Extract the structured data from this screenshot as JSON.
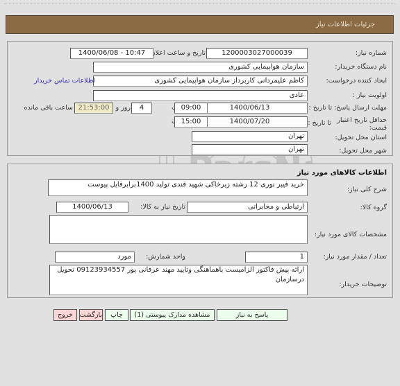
{
  "header": {
    "title": "جزئیات اطلاعات نیاز"
  },
  "details": {
    "need_number_label": "شماره نیاز:",
    "need_number": "1200003027000039",
    "announce_label": "تاریخ و ساعت اعلان عمومی:",
    "announce_value": "1400/06/08 - 10:47",
    "buyer_org_label": "نام دستگاه خریدار:",
    "buyer_org": "سازمان هواپیمایی کشوری",
    "creator_label": "ایجاد کننده درخواست:",
    "creator": "کاظم  علیمردانی کاربرداز سازمان هواپیمایی کشوری",
    "contact_link": "اطلاعات تماس خریدار",
    "priority_label": "اولویت نیاز :",
    "priority": "عادی",
    "deadline_label": "مهلت ارسال پاسخ: تا تاریخ :",
    "deadline_date": "1400/06/13",
    "time_label": "ساعت",
    "deadline_time": "09:00",
    "days_remaining": "4",
    "days_label": "روز و",
    "time_remaining": "21:53:00",
    "remaining_label": "ساعت باقی مانده",
    "validity_label": "حداقل تاریخ اعتبار قیمت:",
    "validity_to_label": "تا تاریخ :",
    "validity_date": "1400/07/20",
    "validity_time": "15:00",
    "province_label": "استان محل تحویل:",
    "province": "تهران",
    "city_label": "شهر محل تحویل:",
    "city": "تهران"
  },
  "goods": {
    "section_title": "اطلاعات کالاهای مورد نیاز",
    "description_label": "شرح کلی نیاز:",
    "description": "خرید فیبر نوری 12 رشته زیرخاکی شهید قندی تولید 1400برابرفایل پیوست",
    "group_label": "گروه کالا:",
    "group": "ارتباطی و مخابراتی",
    "need_date_label": "تاریخ نیاز به کالا:",
    "need_date": "1400/06/13",
    "specs_label": "مشخصات کالای مورد نیاز:",
    "specs": "",
    "quantity_label": "تعداد / مقدار مورد نیاز:",
    "quantity": "1",
    "unit_label": "واحد شمارش:",
    "unit": "مورد",
    "buyer_notes_label": "توضیحات خریدار:",
    "buyer_notes": "ارائه پیش فاکتور الزامیست باهماهنگی وتایید مهند عرفانی پور 09123934557 تحویل درسازمان"
  },
  "buttons": {
    "respond": "پاسخ به نیاز",
    "attachments": "مشاهده مدارک پیوستی (1)",
    "print": "چاپ",
    "back": "بازگشت",
    "exit": "خروج"
  },
  "colors": {
    "title_bar": "#8b6b43",
    "action_green": "#ecffec",
    "action_pink": "#ffd6d6",
    "countdown_bg": "#efebc7"
  }
}
